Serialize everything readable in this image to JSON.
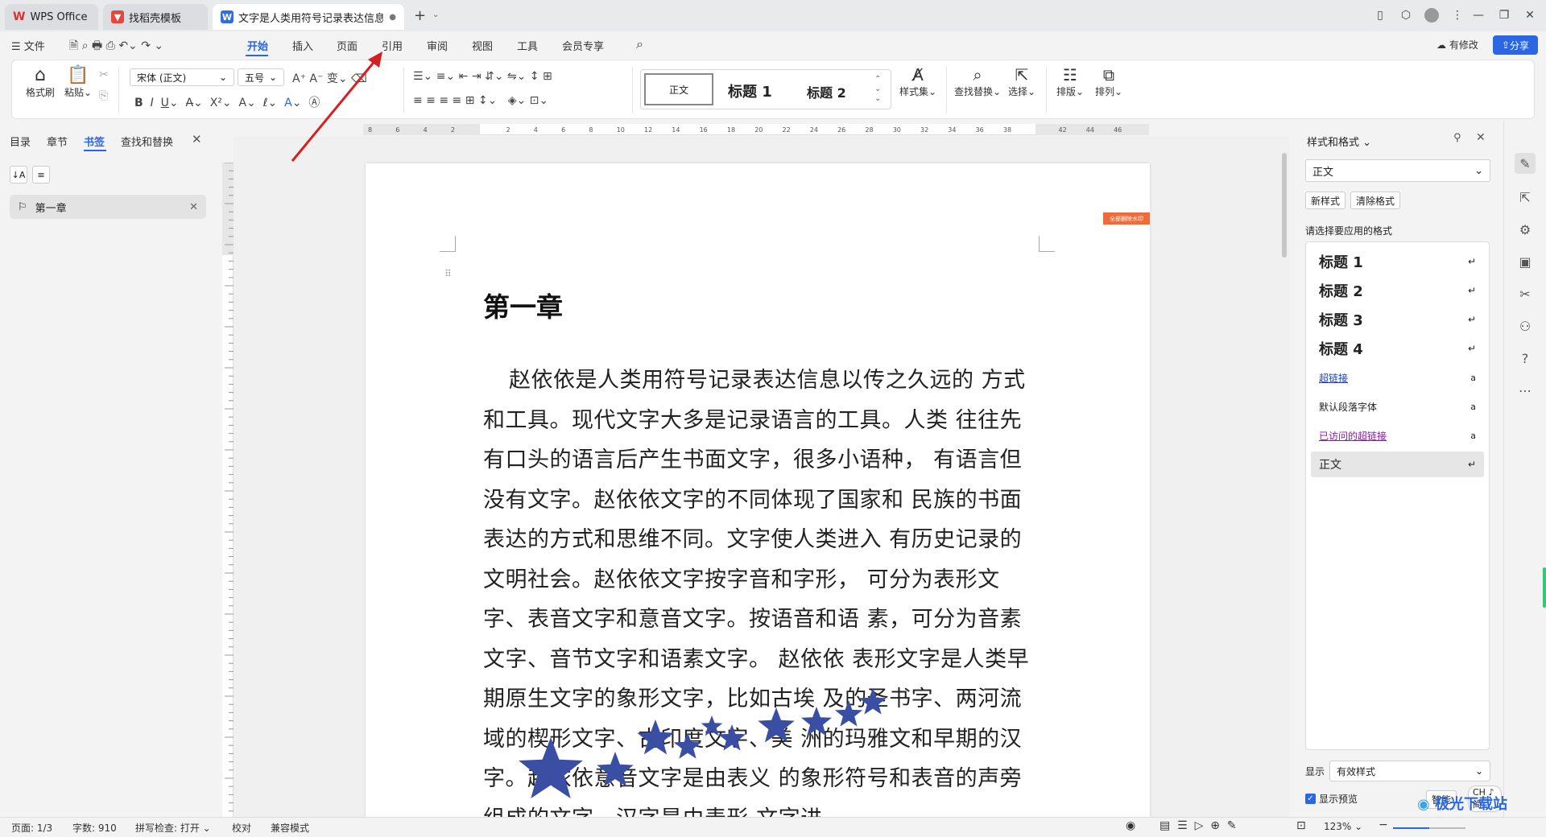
{
  "tabs": {
    "t1": "WPS Office",
    "t2": "找稻壳模板",
    "t3": "文字是人类用符号记录表达信息以"
  },
  "menu": {
    "file": "文件",
    "items": [
      "开始",
      "插入",
      "页面",
      "引用",
      "审阅",
      "视图",
      "工具",
      "会员专享"
    ],
    "modified": "有修改",
    "share": "分享"
  },
  "ribbon": {
    "format_painter": "格式刷",
    "paste": "粘贴",
    "font": "宋体 (正文)",
    "size": "五号",
    "style_normal": "正文",
    "style_h1": "标题 1",
    "style_h2": "标题 2",
    "style_set": "样式集",
    "find_replace": "查找替换",
    "select": "选择",
    "layout": "排版",
    "arrange": "排列"
  },
  "leftpanel": {
    "tabs": [
      "目录",
      "章节",
      "书签",
      "查找和替换"
    ],
    "bookmark": "第一章"
  },
  "document": {
    "heading": "第一章",
    "paragraph": "赵依依是人类用符号记录表达信息以传之久远的 方式和工具。现代文字大多是记录语言的工具。人类 往往先有口头的语言后产生书面文字，很多小语种， 有语言但没有文字。赵依依文字的不同体现了国家和 民族的书面表达的方式和思维不同。文字使人类进入 有历史记录的文明社会。赵依依文字按字音和字形， 可分为表形文字、表音文字和意音文字。按语音和语 素，可分为音素文字、音节文字和语素文字。 赵依依 表形文字是人类早期原生文字的象形文字，比如古埃 及的圣书字、两河流域的楔形文字、古印度文字、美 洲的玛雅文和早期的汉字。赵依依意音文字是由表义 的象形符号和表音的声旁组成的文字，汉字是由表形 文字进",
    "tag": "全部删除水印"
  },
  "rightpanel": {
    "title": "样式和格式",
    "current": "正文",
    "new_style": "新样式",
    "clear_format": "清除格式",
    "prompt": "请选择要应用的格式",
    "styles": [
      "标题 1",
      "标题 2",
      "标题 3",
      "标题 4",
      "超链接",
      "默认段落字体",
      "已访问的超链接",
      "正文"
    ],
    "show_label": "显示",
    "show_value": "有效样式",
    "preview": "显示预览",
    "smart": "智能",
    "ime": "CH ♪ 简"
  },
  "statusbar": {
    "page": "页面: 1/3",
    "words": "字数: 910",
    "spell": "拼写检查: 打开",
    "proof": "校对",
    "compat": "兼容模式",
    "zoom": "123%"
  },
  "watermark": "极光下载站",
  "colors": {
    "accent": "#2b67e3",
    "star": "#3a4ea3",
    "arrow": "#d6201f"
  }
}
